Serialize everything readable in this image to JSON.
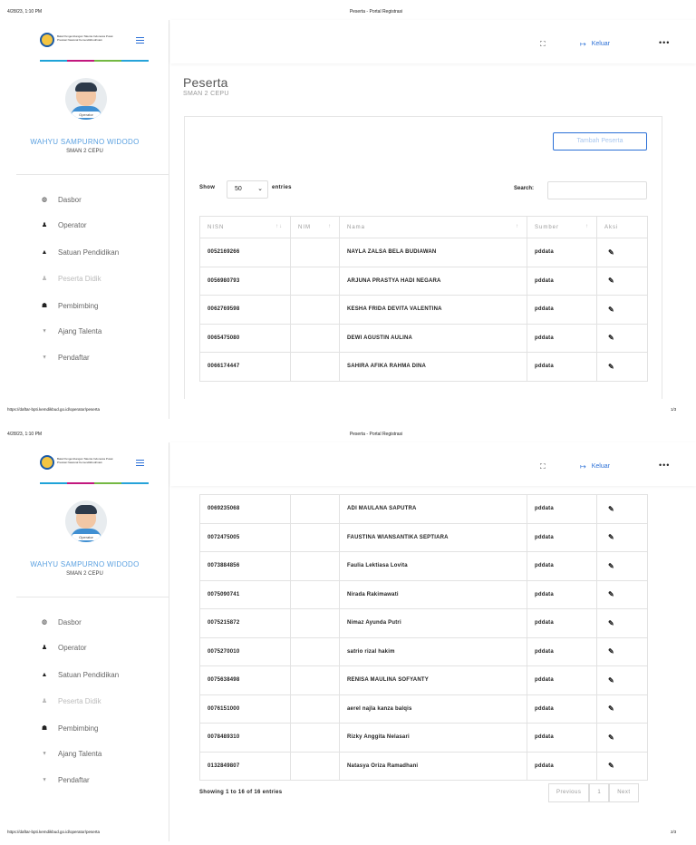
{
  "print": {
    "datetime": "4/28/23, 1:10 PM",
    "doc_title": "Peserta - Portal Registrasi",
    "url": "https://daftar-bpti.kemdikbud.go.id/operator/peserta",
    "page1": "1/3",
    "page2": "2/3"
  },
  "brand": {
    "logo_text": "Balai Pengembangan Talenta Indonesia Pusat Prestasi Nasional Kemendikbudristek",
    "accent": "#2a6fd6"
  },
  "user": {
    "badge": "Operator",
    "name": "WAHYU SAMPURNO WIDODO",
    "school": "SMAN 2 CEPU"
  },
  "menu": [
    {
      "label": "Dasbor",
      "icon": "dashboard-icon",
      "glyph": "◍"
    },
    {
      "label": "Operator",
      "icon": "user-icon",
      "glyph": "♟"
    },
    {
      "label": "Satuan Pendidikan",
      "icon": "graduation-cap-icon",
      "glyph": "🎓"
    },
    {
      "label": "Peserta Didik",
      "icon": "user-icon",
      "glyph": "♟"
    },
    {
      "label": "Pembimbing",
      "icon": "users-icon",
      "glyph": "👥"
    },
    {
      "label": "Ajang Talenta",
      "icon": "trophy-icon",
      "glyph": "🏆"
    },
    {
      "label": "Pendaftar",
      "icon": "trophy-icon",
      "glyph": "🏆"
    }
  ],
  "topbar": {
    "logout_label": "Keluar"
  },
  "page": {
    "title": "Peserta",
    "subtitle": "SMAN 2 CEPU",
    "add_button": "Tambah Peserta"
  },
  "table_controls": {
    "show_label": "Show",
    "page_size": "50",
    "entries_label": "entries",
    "search_label": "Search:",
    "search_value": ""
  },
  "columns": [
    "NISN",
    "NIM",
    "Nama",
    "Sumber",
    "Aksi"
  ],
  "rows_page1": [
    {
      "nisn": "0052169266",
      "nim": "",
      "nama": "NAYLA ZALSA BELA BUDIAWAN",
      "sumber": "pddata"
    },
    {
      "nisn": "0056980793",
      "nim": "",
      "nama": "ARJUNA PRASTYA HADI NEGARA",
      "sumber": "pddata"
    },
    {
      "nisn": "0062769598",
      "nim": "",
      "nama": "KESHA FRIDA DEVITA VALENTINA",
      "sumber": "pddata"
    },
    {
      "nisn": "0065475080",
      "nim": "",
      "nama": "DEWI AGUSTIN AULINA",
      "sumber": "pddata"
    },
    {
      "nisn": "0066174447",
      "nim": "",
      "nama": "SAHIRA AFIKA RAHMA DINA",
      "sumber": "pddata"
    }
  ],
  "rows_page2": [
    {
      "nisn": "0069235068",
      "nim": "",
      "nama": "ADI MAULANA SAPUTRA",
      "sumber": "pddata"
    },
    {
      "nisn": "0072475005",
      "nim": "",
      "nama": "FAUSTINA WIANSANTIKA SEPTIARA",
      "sumber": "pddata"
    },
    {
      "nisn": "0073884856",
      "nim": "",
      "nama": "Faulia Lektiasa Lovita",
      "sumber": "pddata"
    },
    {
      "nisn": "0075090741",
      "nim": "",
      "nama": "Nirada Rakimawati",
      "sumber": "pddata"
    },
    {
      "nisn": "0075215872",
      "nim": "",
      "nama": "Nimaz Ayunda Putri",
      "sumber": "pddata"
    },
    {
      "nisn": "0075270010",
      "nim": "",
      "nama": "satrio rizal hakim",
      "sumber": "pddata"
    },
    {
      "nisn": "0075638498",
      "nim": "",
      "nama": "RENISA MAULINA SOFYANTY",
      "sumber": "pddata"
    },
    {
      "nisn": "0076151000",
      "nim": "",
      "nama": "aerel najla kanza balqis",
      "sumber": "pddata"
    },
    {
      "nisn": "0078489310",
      "nim": "",
      "nama": "Rizky Anggita Nelasari",
      "sumber": "pddata"
    },
    {
      "nisn": "0132849807",
      "nim": "",
      "nama": "Natasya Oriza Ramadhani",
      "sumber": "pddata"
    }
  ],
  "footer": {
    "showing": "Showing 1 to 16 of 16 entries",
    "previous": "Previous",
    "current_page": "1",
    "next": "Next"
  },
  "icons": {
    "edit": "pencil-icon",
    "expand": "fullscreen-icon",
    "logout": "logout-icon",
    "more": "more-dots-icon"
  }
}
